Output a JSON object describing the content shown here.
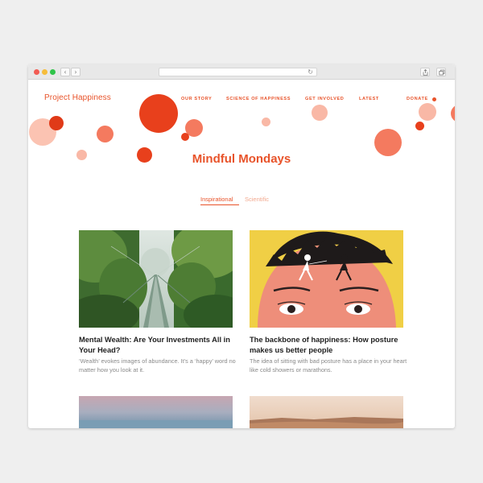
{
  "site": {
    "logo": "Project Happiness",
    "nav": [
      "OUR STORY",
      "SCIENCE OF HAPPINESS",
      "GET INVOLVED",
      "LATEST",
      "DONATE"
    ]
  },
  "page": {
    "title": "Mindful Mondays",
    "tabs": [
      "Inspirational",
      "Scientific"
    ],
    "active_tab": "Inspirational"
  },
  "articles": [
    {
      "title": "Mental Wealth: Are Your Investments All in Your Head?",
      "excerpt": "‘Wealth’ evokes images of abundance. It’s a ‘happy’ word no matter how you look at it.",
      "image": "jungle-suspension-bridge"
    },
    {
      "title": "The backbone of happiness: How posture makes us better people",
      "excerpt": "The idea of sitting with bad posture has a place in your heart like cold showers or marathons.",
      "image": "fencers-on-head-illustration"
    },
    {
      "image": "pink-sky-landscape"
    },
    {
      "image": "desert-dunes"
    }
  ],
  "colors": {
    "brand": "#e8532a",
    "brand_light": "#f2a98f",
    "bubble_dark": "#e8401c",
    "bubble_mid": "#f47a5f",
    "bubble_light": "#f9b8a6"
  },
  "icons": [
    "back-icon",
    "forward-icon",
    "reload-icon",
    "share-icon",
    "tabs-icon"
  ]
}
